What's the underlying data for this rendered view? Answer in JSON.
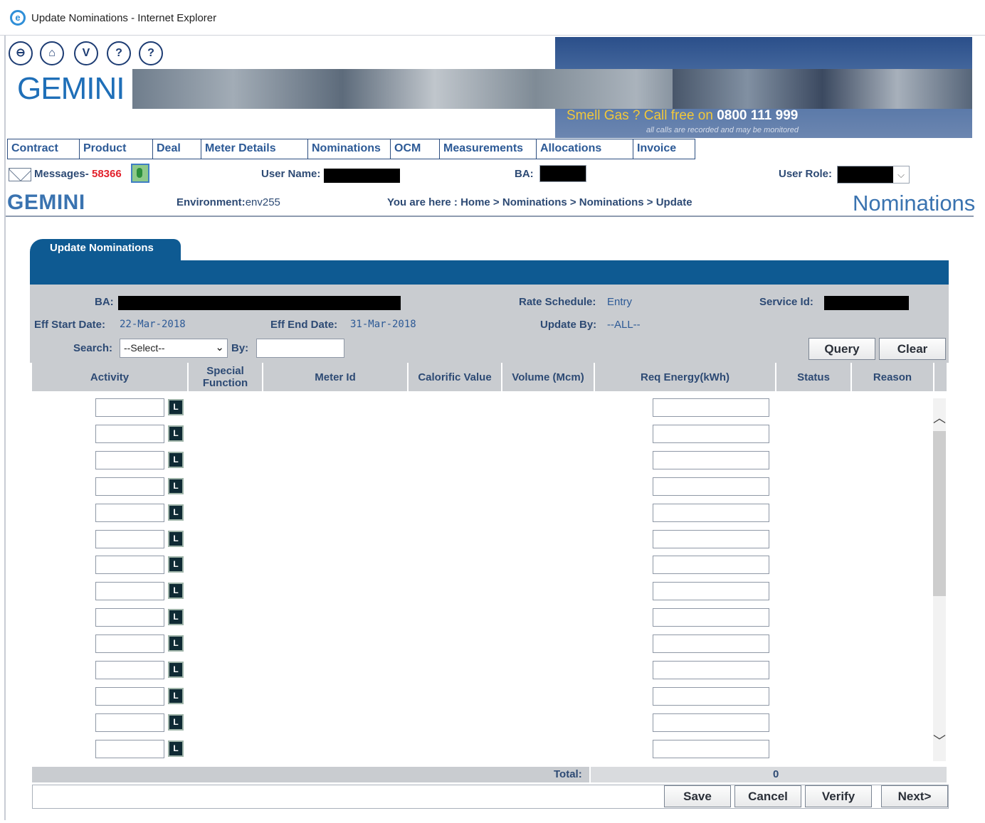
{
  "window": {
    "title": "Update Nominations - Internet Explorer",
    "browser_icon": "ie-icon"
  },
  "header": {
    "toolbar_icons": [
      {
        "name": "print-icon",
        "glyph": "⊖"
      },
      {
        "name": "home-icon",
        "glyph": "⌂"
      },
      {
        "name": "version-icon",
        "glyph": "V"
      },
      {
        "name": "help-icon",
        "glyph": "?"
      },
      {
        "name": "info-help-icon",
        "glyph": "?"
      }
    ],
    "logo": "GEMINI",
    "banner_text": "Smell Gas ? Call free on",
    "banner_phone": "0800 111 999",
    "banner_note": "all calls are recorded and may be monitored"
  },
  "menu": [
    "Contract",
    "Product",
    "Deal",
    "Meter Details",
    "Nominations",
    "OCM",
    "Measurements",
    "Allocations",
    "Invoice"
  ],
  "info": {
    "messages_label": "Messages-",
    "messages_count": "58366",
    "user_name_label": "User Name:",
    "ba_label": "BA:",
    "user_role_label": "User Role:"
  },
  "subheader": {
    "logo": "GEMINI",
    "environment_label": "Environment:",
    "environment_value": "env255",
    "breadcrumb": "You are here : Home > Nominations > Nominations > Update",
    "section": "Nominations"
  },
  "panel": {
    "tab_label": "Update Nominations",
    "ba_label": "BA:",
    "rate_schedule_label": "Rate Schedule:",
    "rate_schedule_value": "Entry",
    "service_id_label": "Service Id:",
    "eff_start_label": "Eff Start Date:",
    "eff_start_value": "22-Mar-2018",
    "eff_end_label": "Eff End Date:",
    "eff_end_value": "31-Mar-2018",
    "update_by_label": "Update By:",
    "update_by_value": "--ALL--",
    "search_label": "Search:",
    "search_value": "--Select--",
    "by_label": "By:",
    "by_value": "",
    "query_button": "Query",
    "clear_button": "Clear"
  },
  "grid": {
    "columns": [
      "Activity",
      "Special Function",
      "Meter Id",
      "Calorific Value",
      "Volume (Mcm)",
      "Req Energy(kWh)",
      "Status",
      "Reason"
    ],
    "lookup_glyph": "L",
    "row_count": 14
  },
  "footer": {
    "total_label": "Total:",
    "total_value": "0",
    "save_button": "Save",
    "cancel_button": "Cancel",
    "verify_button": "Verify",
    "next_button": "Next>"
  }
}
